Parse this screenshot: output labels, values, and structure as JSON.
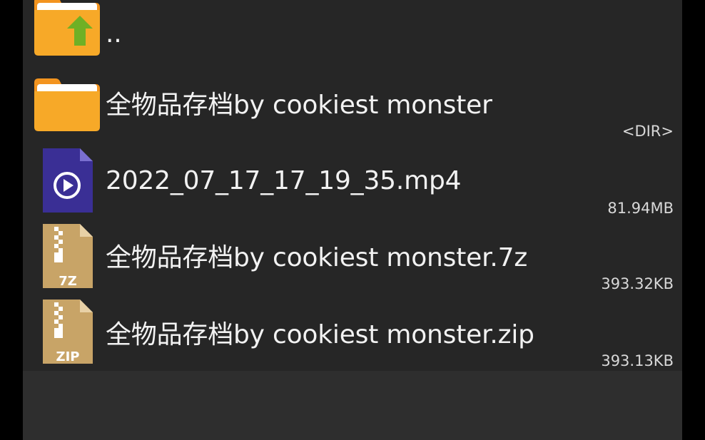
{
  "colors": {
    "background": "#262626",
    "folder": "#f7a928",
    "folder_dark": "#f3941f",
    "up_arrow": "#6fb025",
    "video_file": "#3a2f95",
    "archive_file": "#c8a467",
    "text": "#f2f2f2"
  },
  "files": [
    {
      "name": "..",
      "meta": "",
      "icon": "folder-up-icon"
    },
    {
      "name": "全物品存档by cookiest monster",
      "meta": "<DIR>",
      "icon": "folder-icon"
    },
    {
      "name": "2022_07_17_17_19_35.mp4",
      "meta": "81.94MB",
      "icon": "video-file-icon"
    },
    {
      "name": "全物品存档by cookiest monster.7z",
      "meta": "393.32KB",
      "icon": "archive-7z-icon",
      "badge": "7Z"
    },
    {
      "name": "全物品存档by cookiest monster.zip",
      "meta": "393.13KB",
      "icon": "archive-zip-icon",
      "badge": "ZIP"
    }
  ]
}
